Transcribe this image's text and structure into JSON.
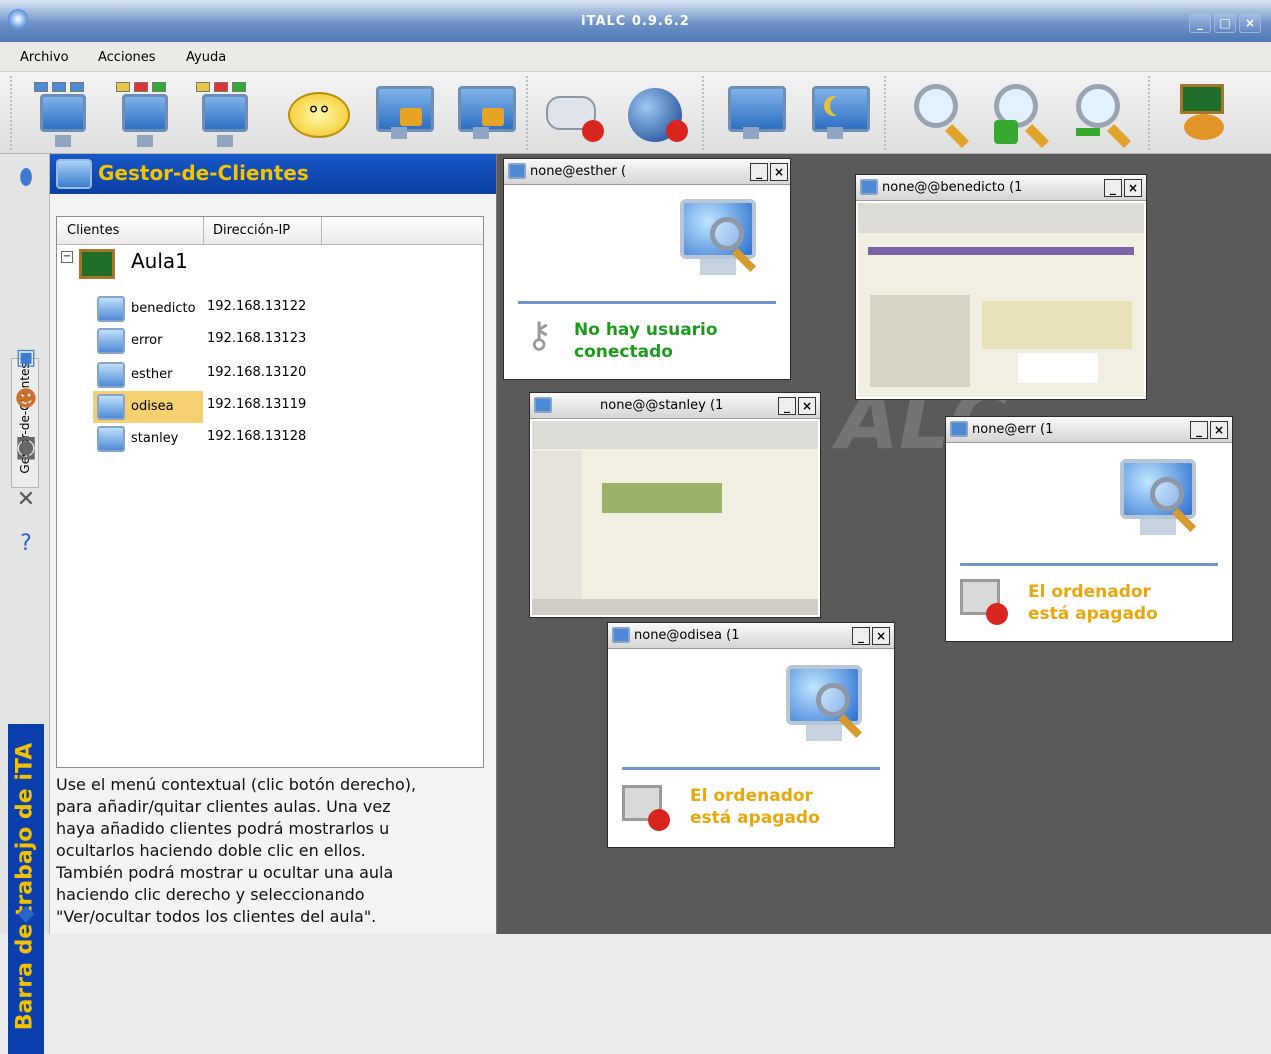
{
  "window": {
    "title": "iTALC 0.9.6.2"
  },
  "menu": {
    "items": [
      "Archivo",
      "Acciones",
      "Ayuda"
    ]
  },
  "toolbar": {
    "icons": [
      "classroom-overview-icon",
      "demo-icon",
      "fullscreen-demo-icon",
      "message-icon",
      "lock-icon",
      "unlock-icon",
      "games-disabled-icon",
      "internet-disabled-icon",
      "restart-icon",
      "power-down-icon",
      "zoom-fit-icon",
      "zoom-in-icon",
      "zoom-out-icon",
      "classroom-icon"
    ]
  },
  "sidebar": {
    "tab_clients": "Gestor-de-Clientes",
    "tab_workbar": "Barra de trabajo de iTA"
  },
  "panel": {
    "title": "Gestor-de-Clientes",
    "columns": [
      "Clientes",
      "Dirección-IP"
    ],
    "classroom": "Aula1",
    "clients": [
      {
        "name": "benedicto",
        "ip": "192.168.13122"
      },
      {
        "name": "error",
        "ip": "192.168.13123"
      },
      {
        "name": "esther",
        "ip": "192.168.13120"
      },
      {
        "name": "odisea",
        "ip": "192.168.13119"
      },
      {
        "name": "stanley",
        "ip": "192.168.13128"
      }
    ],
    "help_lines": [
      "Use el menú contextual (clic botón derecho),",
      "para añadir/quitar clientes aulas. Una vez",
      "haya añadido clientes podrá mostrarlos u",
      "ocultarlos haciendo doble clic en ellos.",
      "También podrá mostrar u ocultar una aula",
      "haciendo clic derecho y seleccionando",
      "\"Ver/ocultar todos los clientes del aula\"."
    ]
  },
  "clientwindows": [
    {
      "title": "none@esther (",
      "status1": "No hay usuario",
      "status2": "conectado"
    },
    {
      "title": "none@@benedicto (1"
    },
    {
      "title": "none@@stanley (1"
    },
    {
      "title": "none@err    (1",
      "status1": "El ordenador",
      "status2": "está apagado"
    },
    {
      "title": "none@odisea (1",
      "status1": "El ordenador",
      "status2": "está apagado"
    }
  ],
  "colors": {
    "accent": "#0b3fa3",
    "status_green": "#1e9a1e",
    "status_orange": "#e8a70c"
  },
  "window_buttons": {
    "minimize": "_",
    "maximize": "□",
    "close": "×"
  }
}
